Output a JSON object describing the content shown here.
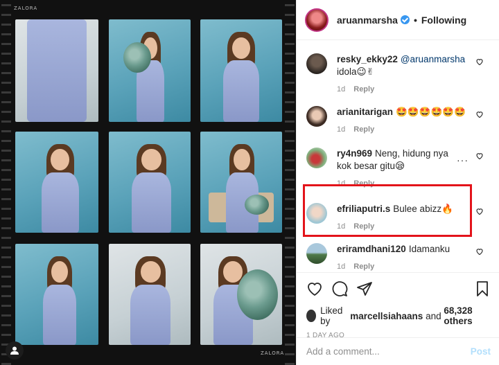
{
  "post": {
    "username": "aruanmarsha",
    "follow_state": "Following",
    "separator": "•",
    "film_brand": "ZALORA"
  },
  "comments": [
    {
      "user": "resky_ekky22",
      "mention": "@aruanmarsha",
      "text": "idola😉✌",
      "age": "1d",
      "reply": "Reply"
    },
    {
      "user": "arianitarigan",
      "mention": "",
      "text": "🤩🤩🤩🤩🤩🤩",
      "age": "1d",
      "reply": "Reply"
    },
    {
      "user": "ry4n969",
      "mention": "",
      "text": "Neng, hidung nya kok besar gitu😪",
      "age": "1d",
      "reply": "Reply",
      "options": "···"
    },
    {
      "user": "efriliaputri.s",
      "mention": "",
      "text": "Bulee abizz🔥",
      "age": "1d",
      "reply": "Reply"
    },
    {
      "user": "eriramdhani120",
      "mention": "",
      "text": "Idamanku",
      "age": "1d",
      "reply": "Reply"
    }
  ],
  "likes": {
    "prefix": "Liked by",
    "user": "marcellsiahaans",
    "connector": "and",
    "others": "68,328 others"
  },
  "date": "1 DAY AGO",
  "add_comment": {
    "placeholder": "Add a comment...",
    "post_label": "Post"
  },
  "colors": {
    "accent_blue": "#3897f0",
    "highlight_red": "#e3131a",
    "post_disabled": "#b2dffc"
  },
  "icons": [
    "heart-icon",
    "comment-icon",
    "share-icon",
    "bookmark-icon",
    "verified-badge-icon",
    "user-icon"
  ]
}
